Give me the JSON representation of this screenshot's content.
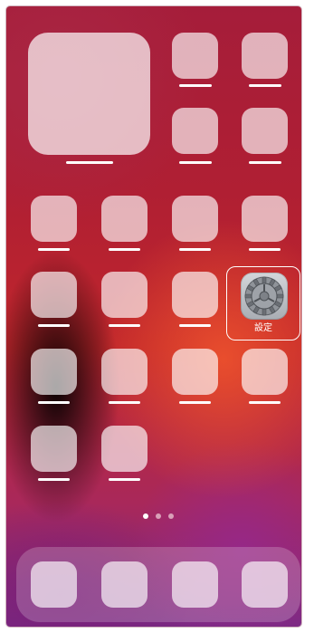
{
  "home_screen": {
    "settings_app": {
      "label": "設定",
      "icon": "gear-icon"
    },
    "page_indicator": {
      "pages": 3,
      "current_page": 1
    },
    "colors": {
      "placeholder_icon": "#f2eef2",
      "label_bar": "#ffffff",
      "active_dot": "#ffffff",
      "inactive_dot": "#d9a0b8"
    }
  }
}
